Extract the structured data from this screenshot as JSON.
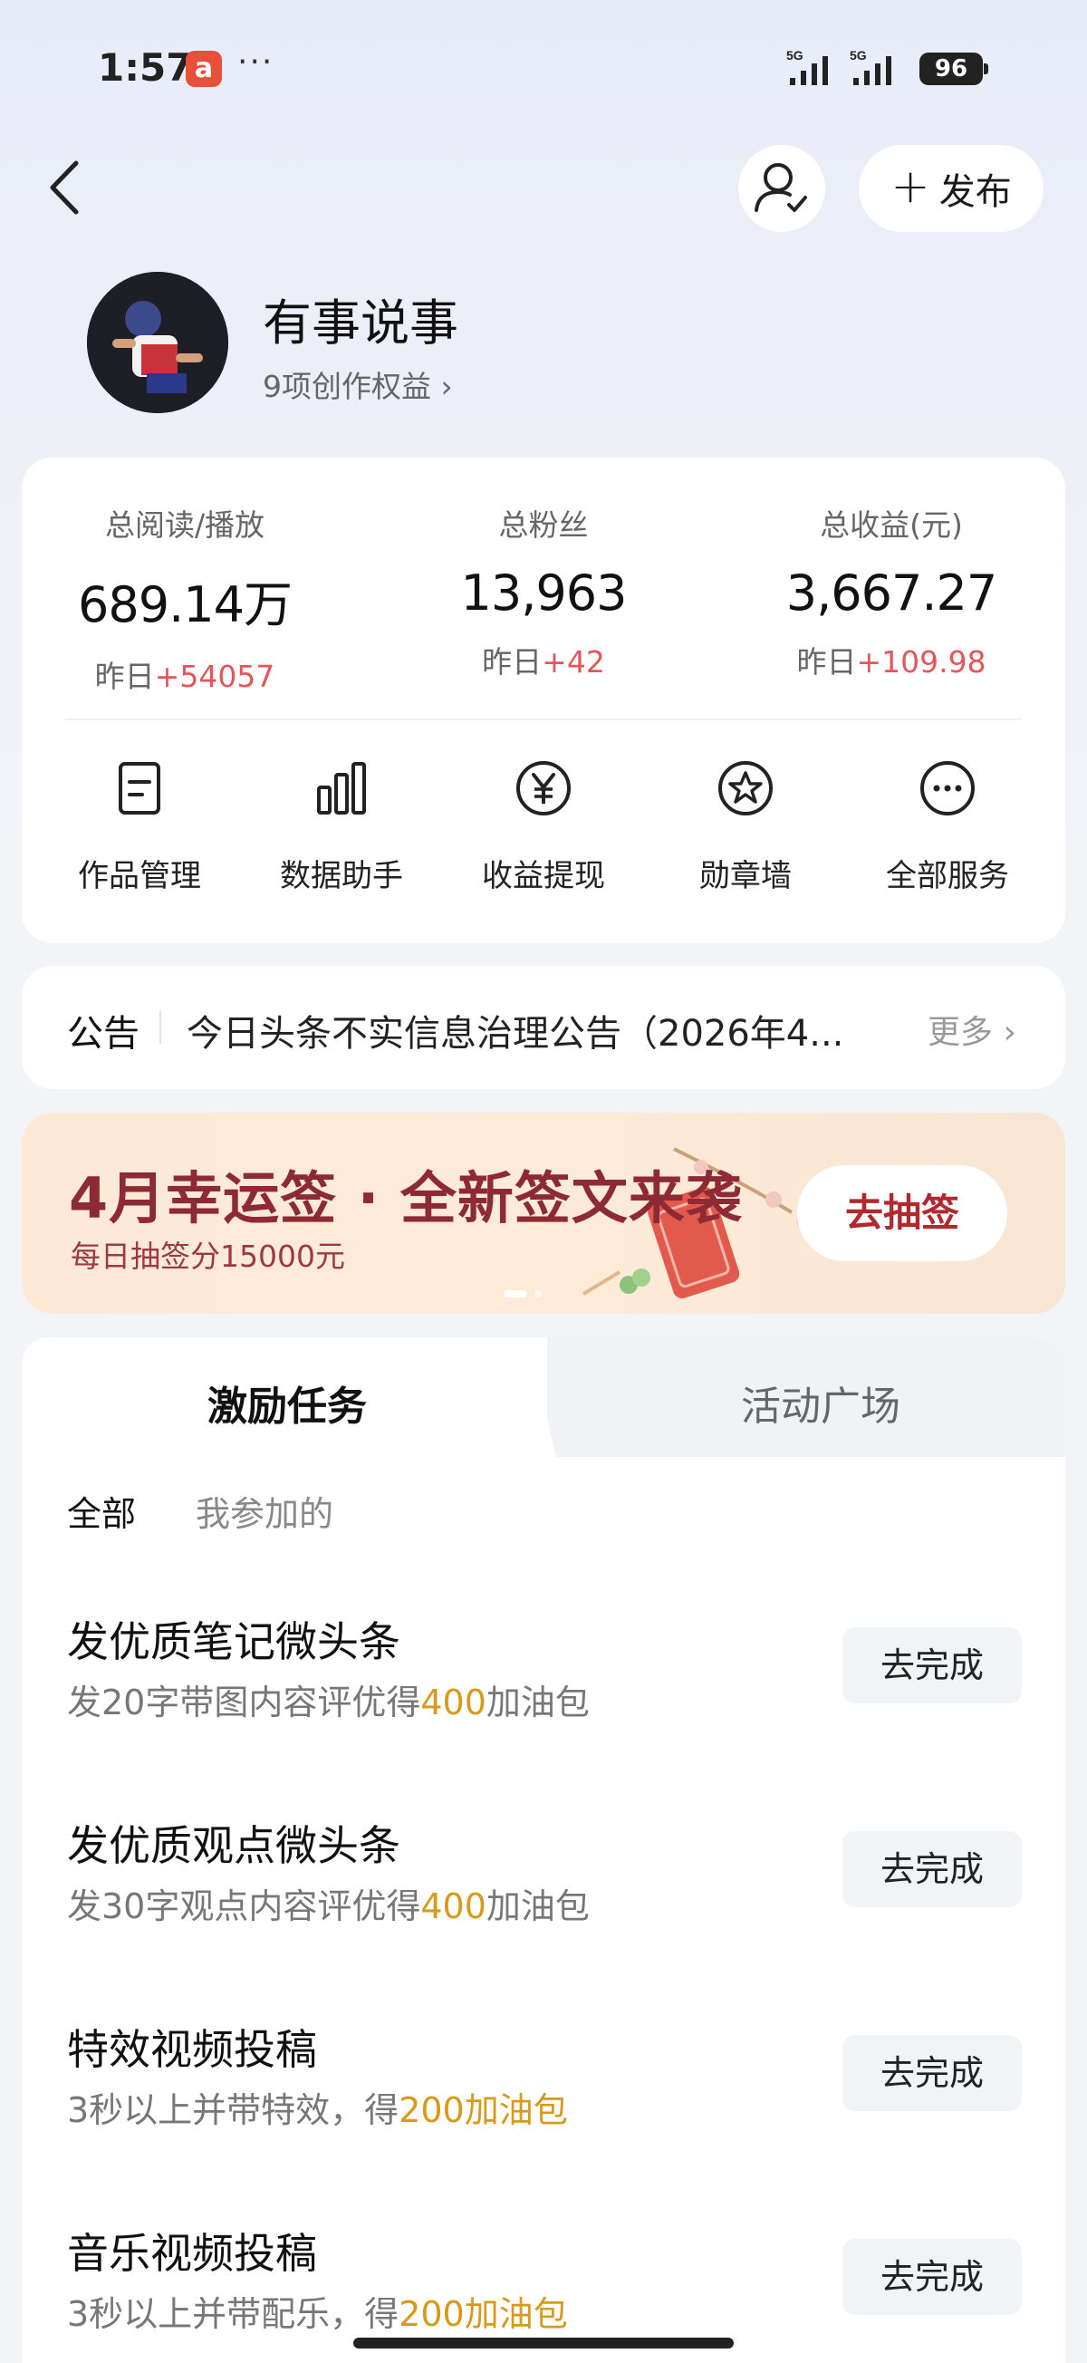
{
  "status_bar": {
    "time": "1:57",
    "app_badge": "a",
    "more": "···",
    "signal1": "5G",
    "signal2": "5G",
    "battery": "96"
  },
  "header": {
    "publish_label": "发布"
  },
  "profile": {
    "nickname": "有事说事",
    "benefits": "9项创作权益 ›"
  },
  "stats": [
    {
      "label": "总阅读/播放",
      "value": "689.14万",
      "delta_prefix": "昨日",
      "delta": "+54057"
    },
    {
      "label": "总粉丝",
      "value": "13,963",
      "delta_prefix": "昨日",
      "delta": "+42"
    },
    {
      "label": "总收益(元)",
      "value": "3,667.27",
      "delta_prefix": "昨日",
      "delta": "+109.98"
    }
  ],
  "tools": [
    {
      "label": "作品管理",
      "icon": "document-icon"
    },
    {
      "label": "数据助手",
      "icon": "bar-chart-icon"
    },
    {
      "label": "收益提现",
      "icon": "yen-icon"
    },
    {
      "label": "勋章墙",
      "icon": "badge-icon"
    },
    {
      "label": "全部服务",
      "icon": "more-icon"
    }
  ],
  "notice": {
    "tag": "公告",
    "text": "今日头条不实信息治理公告（2026年4...",
    "more": "更多 ›"
  },
  "banner": {
    "title": "4月幸运签 · 全新签文来袭",
    "subtitle": "每日抽签分15000元",
    "cta": "去抽签"
  },
  "tasks": {
    "tabs": [
      "激励任务",
      "活动广场"
    ],
    "filters": [
      "全部",
      "我参加的"
    ],
    "items": [
      {
        "title": "发优质笔记微头条",
        "desc_pre": "发20字带图内容评优得",
        "highlight": "400",
        "desc_post": "加油包",
        "button": "去完成"
      },
      {
        "title": "发优质观点微头条",
        "desc_pre": "发30字观点内容评优得",
        "highlight": "400",
        "desc_post": "加油包",
        "button": "去完成"
      },
      {
        "title": "特效视频投稿",
        "desc_pre": "3秒以上并带特效，得",
        "highlight": "200加油包",
        "desc_post": "",
        "button": "去完成"
      },
      {
        "title": "音乐视频投稿",
        "desc_pre": "3秒以上并带配乐，得",
        "highlight": "200加油包",
        "desc_post": "",
        "button": "去完成"
      }
    ]
  },
  "colors": {
    "accent_red": "#e5565b",
    "highlight_gold": "#d89a1d",
    "banner_title": "#8e2a33"
  }
}
